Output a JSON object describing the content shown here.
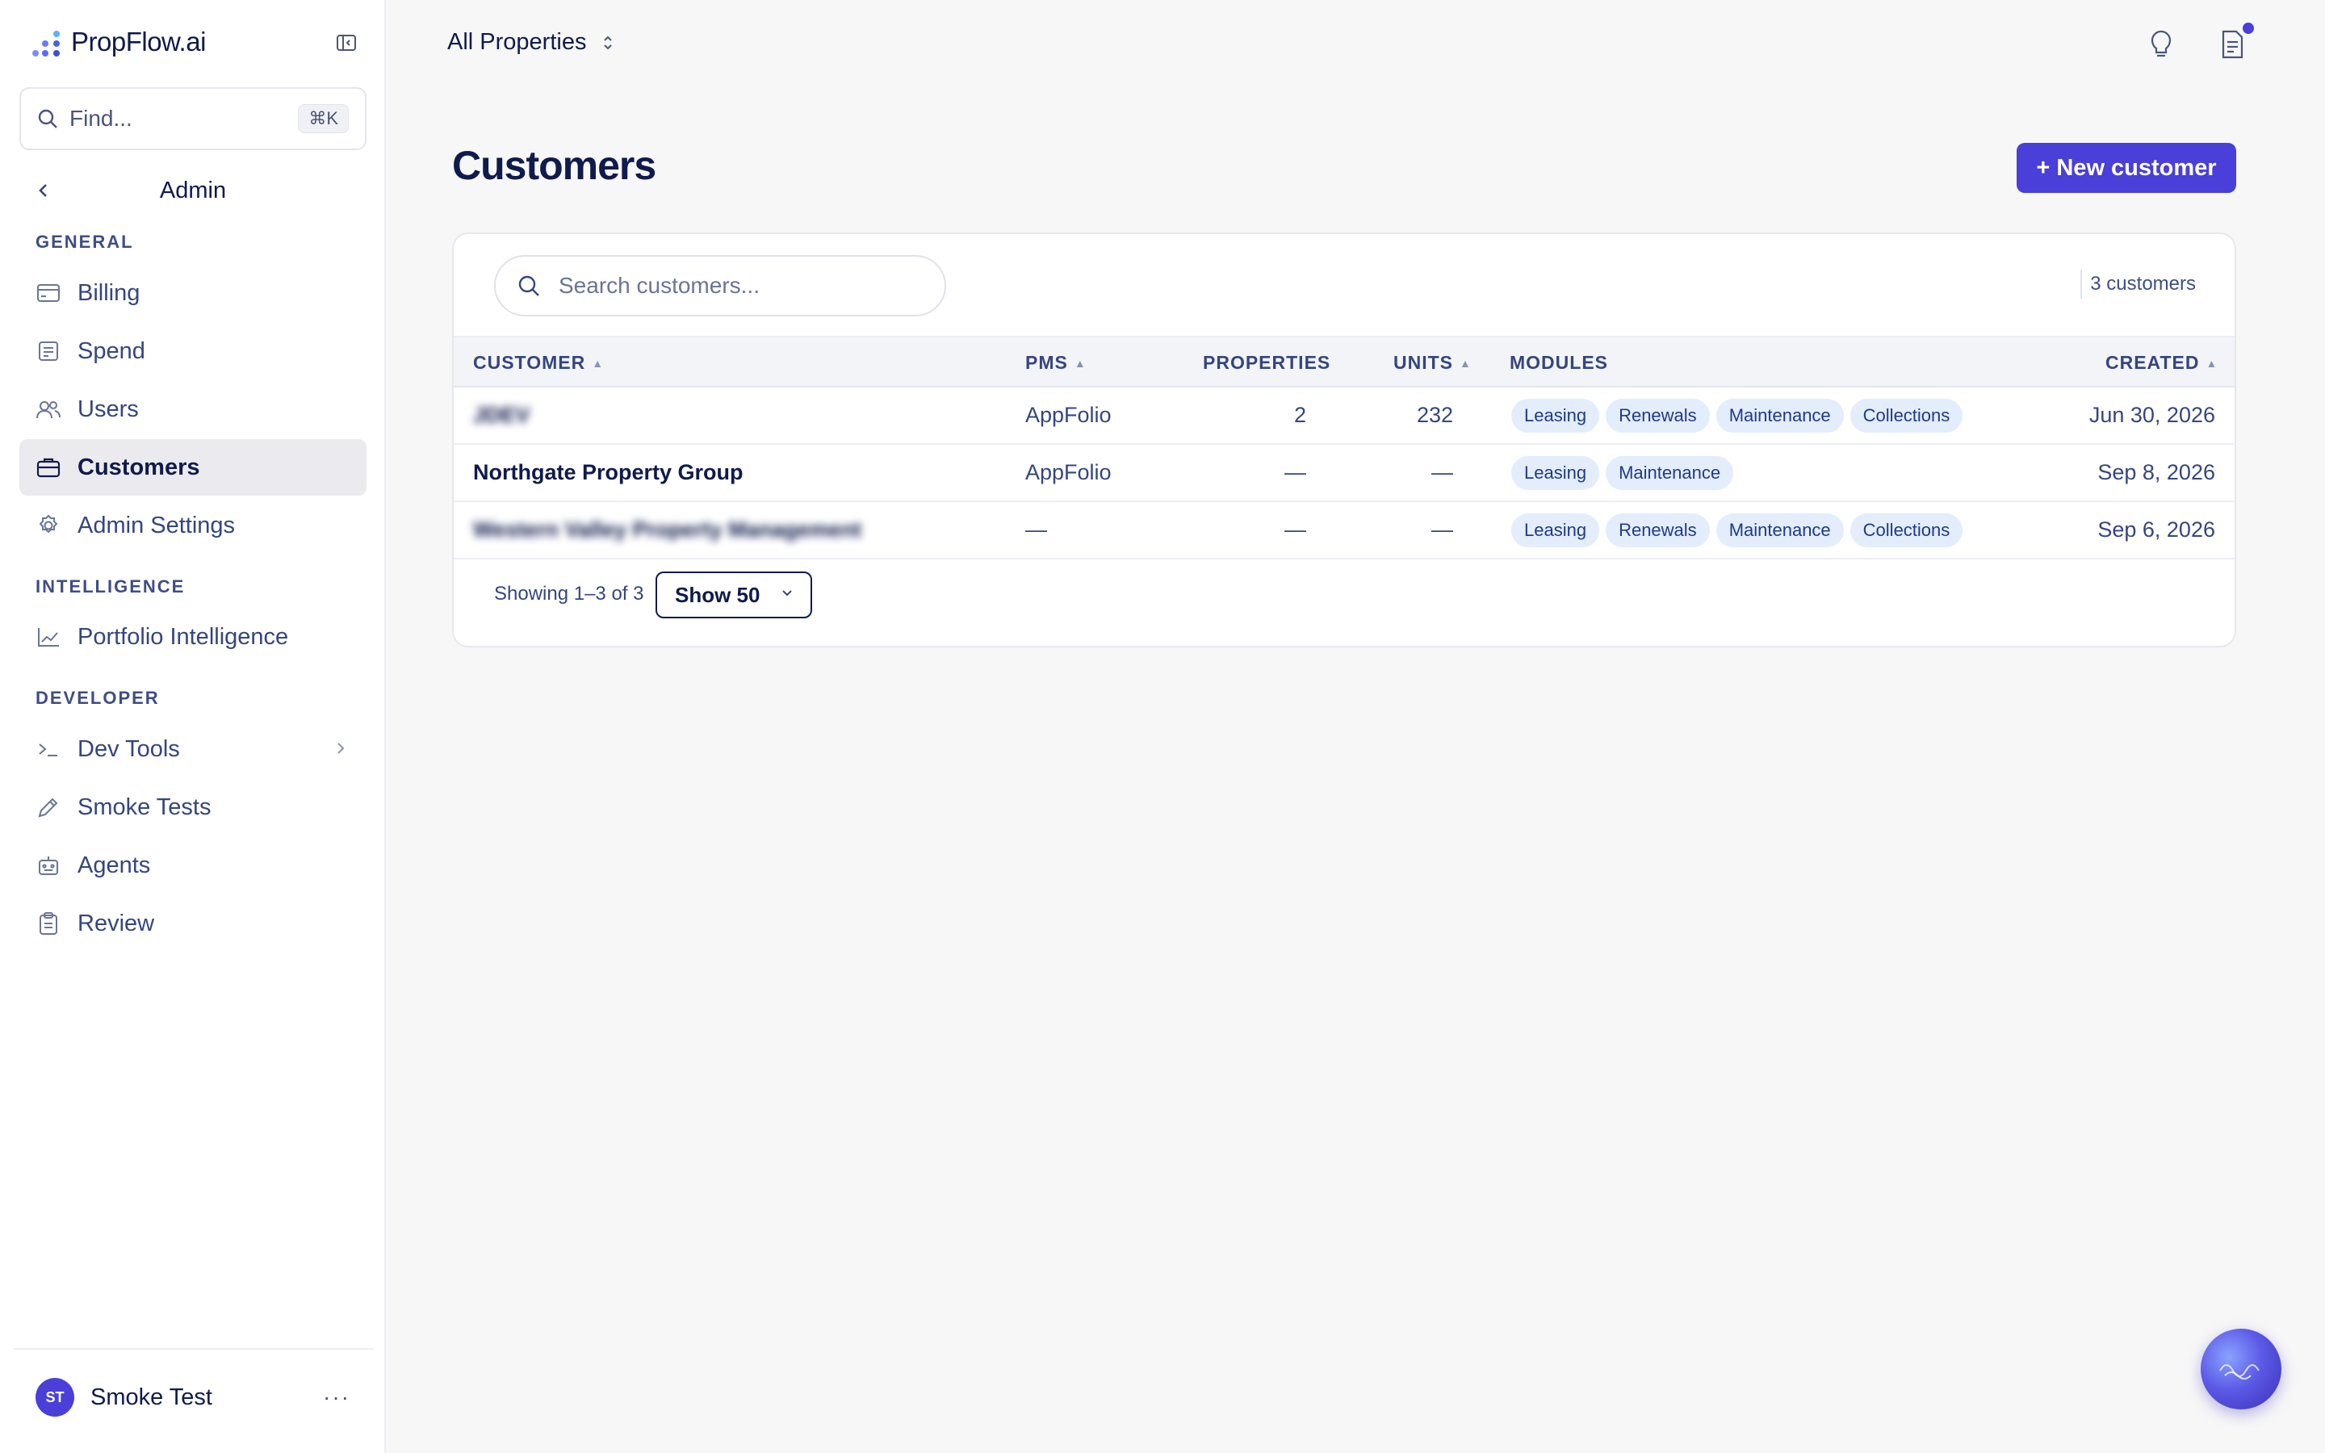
{
  "app": {
    "brand": "PropFlow.ai"
  },
  "sidebar": {
    "find_placeholder": "Find...",
    "find_shortcut": "⌘K",
    "admin_title": "Admin",
    "sections": {
      "general": "GENERAL",
      "intelligence": "INTELLIGENCE",
      "developer": "DEVELOPER"
    },
    "items": [
      {
        "label": "Billing",
        "icon": "credit-card-icon"
      },
      {
        "label": "Spend",
        "icon": "receipt-icon"
      },
      {
        "label": "Users",
        "icon": "users-icon"
      },
      {
        "label": "Customers",
        "icon": "briefcase-icon",
        "active": true
      },
      {
        "label": "Admin Settings",
        "icon": "gear-icon"
      },
      {
        "label": "Portfolio Intelligence",
        "icon": "chart-line-icon"
      },
      {
        "label": "Dev Tools",
        "icon": "terminal-icon"
      },
      {
        "label": "Smoke Tests",
        "icon": "pencil-icon"
      },
      {
        "label": "Agents",
        "icon": "robot-icon"
      },
      {
        "label": "Review",
        "icon": "clipboard-icon"
      }
    ],
    "user": {
      "initials": "ST",
      "name": "Smoke Test"
    }
  },
  "topbar": {
    "property_selector": "All Properties"
  },
  "page": {
    "title": "Customers",
    "new_button": "+ New customer"
  },
  "table": {
    "search_placeholder": "Search customers...",
    "count_label": "3 customers",
    "headers": {
      "customer": "CUSTOMER",
      "pms": "PMS",
      "properties": "PROPERTIES",
      "units": "UNITS",
      "modules": "MODULES",
      "created": "CREATED"
    },
    "rows": [
      {
        "customer": "JDEV",
        "customer_blurred": true,
        "pms": "AppFolio",
        "properties": "2",
        "units": "232",
        "modules": [
          "Leasing",
          "Renewals",
          "Maintenance",
          "Collections"
        ],
        "created": "Jun 30, 2026"
      },
      {
        "customer": "Northgate Property Group",
        "customer_blurred": false,
        "pms": "AppFolio",
        "properties": "—",
        "units": "—",
        "modules": [
          "Leasing",
          "Maintenance"
        ],
        "created": "Sep 8, 2026"
      },
      {
        "customer": "Western Valley Property Management",
        "customer_blurred": true,
        "pms": "—",
        "properties": "—",
        "units": "—",
        "modules": [
          "Leasing",
          "Renewals",
          "Maintenance",
          "Collections"
        ],
        "created": "Sep 6, 2026"
      }
    ],
    "showing": "Showing 1–3 of 3",
    "page_size": "Show 50"
  },
  "colors": {
    "accent": "#4a3fd9",
    "chip_bg": "#e3edfb",
    "text_primary": "#0f1b4c"
  }
}
